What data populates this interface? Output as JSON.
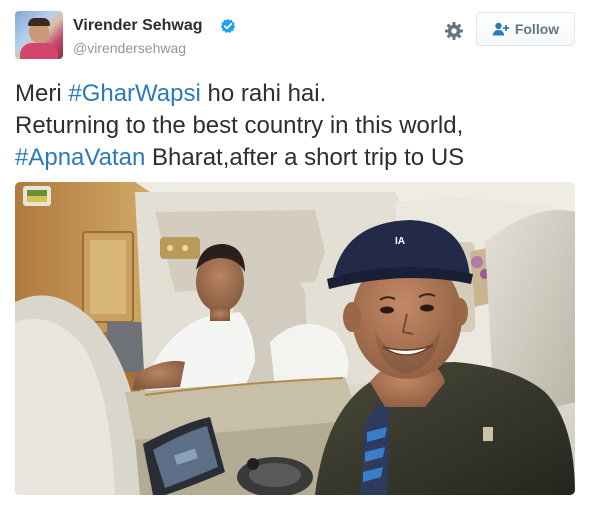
{
  "author": {
    "name": "Virender Sehwag",
    "handle": "@virendersehwag",
    "verified": true,
    "avatar_icon": "avatar-photo"
  },
  "actions": {
    "settings_icon": "gear-icon",
    "follow_label": "Follow",
    "follow_icon": "add-user-icon"
  },
  "tweet": {
    "line1_prefix": "Meri ",
    "line1_hashtag": "#GharWapsi",
    "line1_suffix": " ho rahi hai.",
    "line2": "Returning to the best country in this world,",
    "line3_hashtag": "#ApnaVatan",
    "line3_suffix": " Bharat,after a short trip to US"
  },
  "colors": {
    "link": "#2b7bb9",
    "text": "#292f33",
    "secondary": "#8899a6",
    "verified": "#1da1f2"
  }
}
